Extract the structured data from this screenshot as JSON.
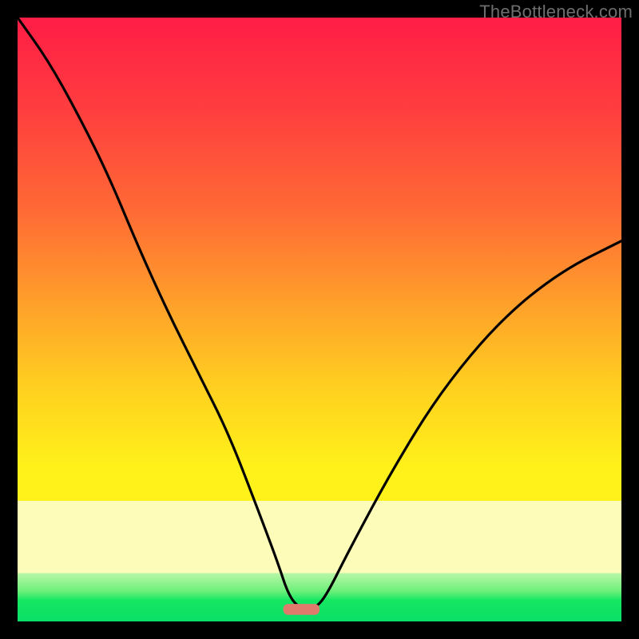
{
  "watermark": {
    "text": "TheBottleneck.com"
  },
  "colors": {
    "gradient_top": "#ff1d46",
    "gradient_mid": "#fff21a",
    "gradient_band": "#fdfcb8",
    "gradient_bottom": "#0adf67",
    "curve": "#000000",
    "page_bg": "#000000"
  },
  "chart_data": {
    "type": "line",
    "title": "",
    "xlabel": "",
    "ylabel": "",
    "xlim": [
      0,
      100
    ],
    "ylim": [
      0,
      100
    ],
    "grid": false,
    "legend": null,
    "notes": "No axes or tick labels are rendered; values are estimated in percent of plot width/height. Curve is a deep V with its minimum near x≈47, y≈2 and a small flat/rounded segment at the trough.",
    "series": [
      {
        "name": "curve",
        "x": [
          0,
          5,
          10,
          15,
          20,
          25,
          30,
          35,
          40,
          43,
          45,
          47,
          49,
          51,
          55,
          62,
          70,
          80,
          90,
          100
        ],
        "y": [
          100,
          93,
          84,
          74,
          62,
          51,
          41,
          31,
          18,
          10,
          4,
          2,
          2,
          4,
          12,
          25,
          38,
          50,
          58,
          63
        ]
      }
    ],
    "marker": {
      "x": 47,
      "y": 2,
      "width_pct": 6,
      "height_pct": 1.8,
      "color": "#e07a6c",
      "shape": "rounded-rect"
    }
  }
}
